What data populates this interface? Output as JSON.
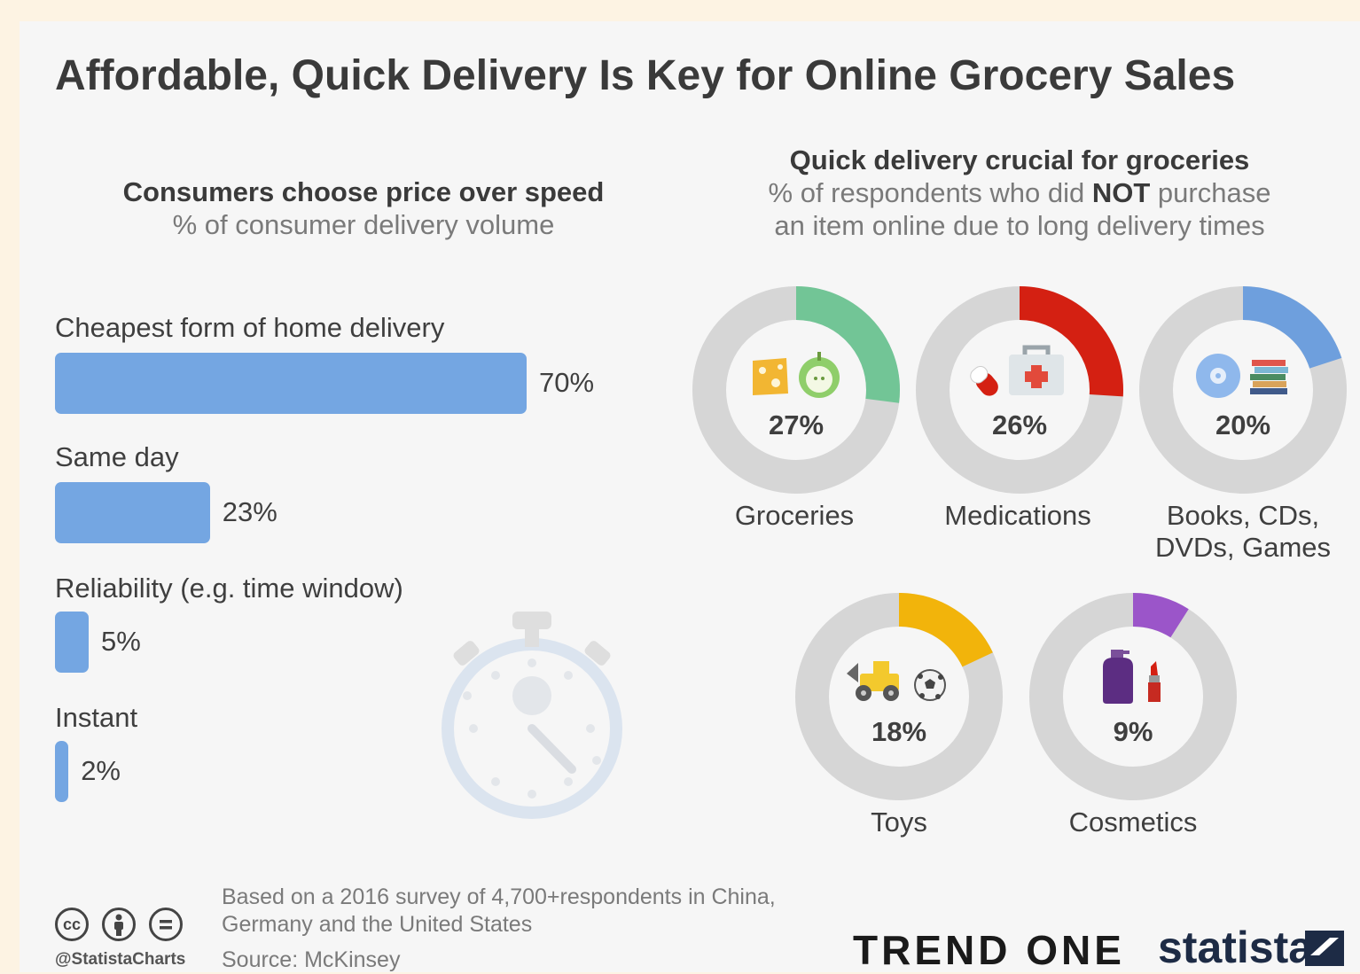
{
  "title": "Affordable, Quick Delivery Is Key for Online Grocery Sales",
  "left": {
    "heading": "Consumers choose price over speed",
    "subheading": "% of consumer delivery volume"
  },
  "right": {
    "heading": "Quick delivery crucial for groceries",
    "sub_pre": "% of respondents who did ",
    "sub_bold": "NOT",
    "sub_post": " purchase",
    "sub_line2": "an item online due to long delivery times"
  },
  "chart_data": [
    {
      "type": "bar",
      "orientation": "horizontal",
      "title": "Consumers choose price over speed",
      "subtitle": "% of consumer delivery volume",
      "categories": [
        "Cheapest form of home delivery",
        "Same day",
        "Reliability (e.g. time window)",
        "Instant"
      ],
      "values": [
        70,
        23,
        5,
        2
      ],
      "labels": [
        "70%",
        "23%",
        "5%",
        "2%"
      ],
      "xlim": [
        0,
        100
      ],
      "color": "#74a6e2"
    },
    {
      "type": "pie",
      "title": "Quick delivery crucial for groceries",
      "subtitle": "% of respondents who did NOT purchase an item online due to long delivery times",
      "categories": [
        "Groceries",
        "Medications",
        "Books, CDs, DVDs, Games",
        "Toys",
        "Cosmetics"
      ],
      "values": [
        27,
        26,
        20,
        18,
        9
      ],
      "labels": [
        "27%",
        "26%",
        "20%",
        "18%",
        "9%"
      ],
      "colors": [
        "#72c596",
        "#d42012",
        "#6e9fdd",
        "#f2b40b",
        "#9b55c9"
      ],
      "track_color": "#d6d6d6"
    }
  ],
  "footer": {
    "note_line1": "Based on a 2016 survey of 4,700+respondents in China,",
    "note_line2": "Germany and the United States",
    "source": "Source: McKinsey",
    "handle": "@StatistaCharts",
    "brand1": "TREND ONE",
    "brand2": "statista"
  },
  "icons": [
    "cheese-icon",
    "apple-icon",
    "pill-icon",
    "first-aid-kit-icon",
    "cd-icon",
    "books-icon",
    "toy-truck-icon",
    "soccer-ball-icon",
    "lotion-bottle-icon",
    "lipstick-icon",
    "stopwatch-icon",
    "cc-icon",
    "attribution-icon",
    "no-derivatives-icon"
  ]
}
